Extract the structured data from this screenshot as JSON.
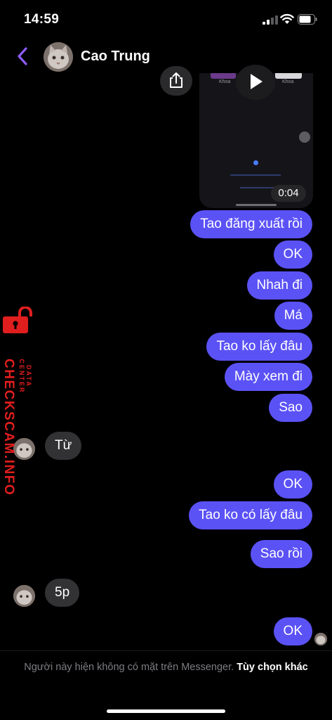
{
  "status_bar": {
    "time": "14:59"
  },
  "header": {
    "contact_name": "Cao Trung"
  },
  "video": {
    "duration": "0:04",
    "preview_label_left": "Khoa",
    "preview_label_right": "Khoa"
  },
  "messages": {
    "m1": "Tao đăng xuất rồi",
    "m2": "OK",
    "m3": "Nhah đi",
    "m4": "Má",
    "m5": "Tao ko lấy đâu",
    "m6": "Mày xem đi",
    "m7": "Sao",
    "m8": "Từ",
    "m9": "OK",
    "m10": "Tao ko có lấy đâu",
    "m11": "Sao rồi",
    "m12": "5p",
    "m13": "OK"
  },
  "watermark": {
    "brand": "CHECKSCAM.INFO",
    "sub": "DATA CENTER"
  },
  "footer": {
    "notice": "Người này hiện không có mặt trên Messenger.",
    "link": "Tùy chọn khác"
  },
  "colors": {
    "accent": "#5b52f6",
    "incoming": "#323235",
    "back_arrow": "#8b5cf6",
    "watermark": "#e01e1e"
  }
}
